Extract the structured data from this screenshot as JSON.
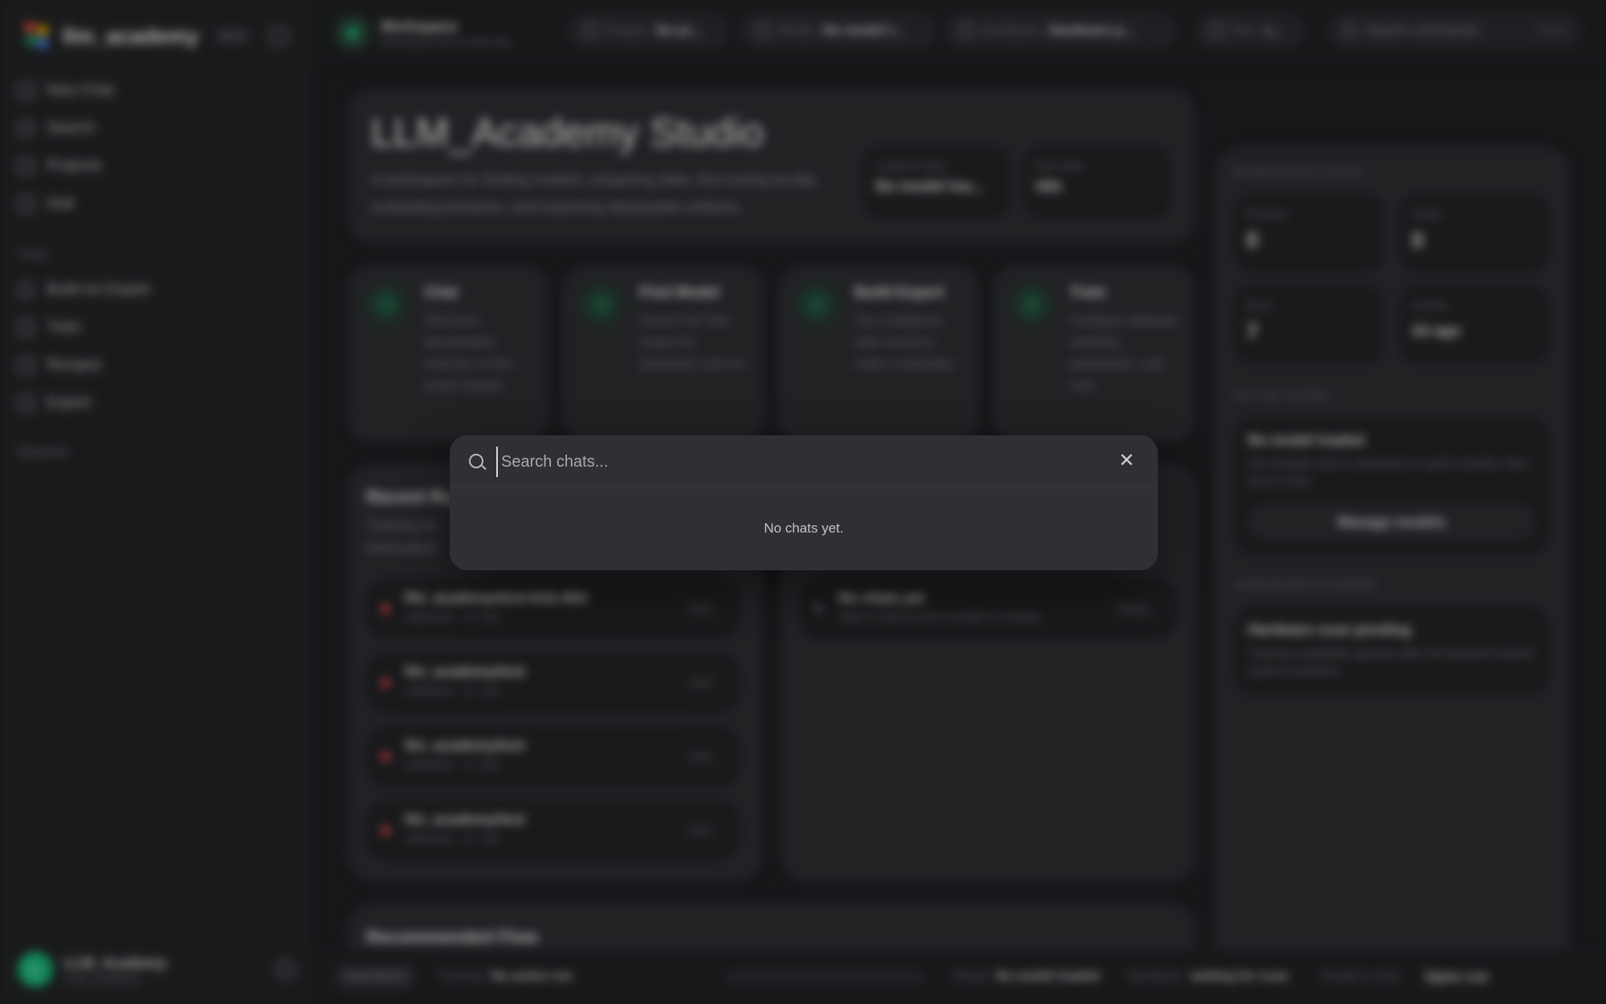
{
  "app": {
    "brand": "llm_academy",
    "beta": "BETA"
  },
  "sidebar": {
    "items": [
      {
        "label": "New Chat",
        "icon": "edit-icon"
      },
      {
        "label": "Search",
        "icon": "search-icon"
      },
      {
        "label": "Projects",
        "icon": "folder-icon"
      },
      {
        "label": "Hub",
        "icon": "grid-icon"
      }
    ],
    "train_label": "Train",
    "train_items": [
      {
        "label": "Build an Expert",
        "icon": "bulb-icon"
      },
      {
        "label": "Train",
        "icon": "flask-icon"
      },
      {
        "label": "Recipes",
        "icon": "chef-icon"
      },
      {
        "label": "Export",
        "icon": "export-icon"
      }
    ],
    "recents_label": "Recents",
    "user": {
      "initial": "L",
      "name": "LLM_Academy",
      "sub": "LLM_Academy"
    }
  },
  "topbar": {
    "workspace_title": "Workspace",
    "workspace_sub": "Workspace-first model lab",
    "project_key": "Project",
    "project_value": "No pr...",
    "model_key": "Model",
    "model_value": "No model l...",
    "hardware_key": "Hardware",
    "hardware_value": "Hardware p...",
    "run_key": "Run",
    "run_value": "i...",
    "search_label": "Search commands",
    "shortcut": "Cmd K"
  },
  "hero": {
    "title": "LLM_Academy Studio",
    "desc": "A workspace for finding models, preparing data, fine-tuning locally, evaluating behavior, and exporting deployable artifacts.",
    "loaded_model_key": "Loaded model",
    "loaded_model_value": "No model loa...",
    "run_state_key": "Run state",
    "run_state_value": "Idle"
  },
  "features": [
    {
      "title": "Chat",
      "desc": "Test base, downloaded, external, or fine-tuned models."
    },
    {
      "title": "Find Model",
      "desc": "Search the Hub, inspect fit, download, and run."
    },
    {
      "title": "Build Expert",
      "desc": "Use a beginner-safe wizard to make a specialist."
    },
    {
      "title": "Train",
      "desc": "Configure datasets, methods, parameters, and runs."
    }
  ],
  "recent_runs": {
    "title": "Recent Ru...",
    "sub": "Training ac... interrupted...",
    "items": [
      {
        "name": "llm_academy/test-bnb-4bit",
        "sub": "unknown · 17 Jun",
        "status": "error"
      },
      {
        "name": "llm_academy/test",
        "sub": "unknown · 17 Jun",
        "status": "error"
      },
      {
        "name": "llm_academy/test",
        "sub": "unknown · 17 Jun",
        "status": "error"
      },
      {
        "name": "llm_academy/test",
        "sub": "unknown · 17 Jun",
        "status": "error"
      }
    ]
  },
  "recent_chats": {
    "item_name": "No chats yet",
    "item_sub": "Start a chat to test a model or compar...",
    "item_badge": "Ready"
  },
  "recommended": {
    "title": "Recommended Flow"
  },
  "workspace_state": {
    "caption": "WORKSPACE STATE",
    "projects_key": "Projects",
    "projects_value": "0",
    "chats_key": "Chats",
    "chats_value": "0",
    "runs_key": "Runs",
    "runs_value": "7",
    "activity_key": "Activity",
    "activity_value": "2d ago"
  },
  "active_model": {
    "caption": "ACTIVE MODEL",
    "title": "No model loaded",
    "desc": "Use Models Hub to download or switch models, then test in Chat.",
    "button": "Manage models"
  },
  "hardware_planner": {
    "caption": "HARDWARE PLANNER",
    "title": "Hardware scan pending",
    "desc": "Training availability appears after the backend reports system hardware."
  },
  "statusbar": {
    "operations": "Operations",
    "training_key": "Training",
    "training_value": "No active run",
    "model_key": "Model",
    "model_value": "No model loaded",
    "hardware_key": "Hardware",
    "hardware_value": "waiting for scan",
    "ready": "Ready to train",
    "open_run": "Open run"
  },
  "dialog": {
    "placeholder": "Search chats...",
    "empty": "No chats yet."
  },
  "colors": {
    "accent": "#1fa06a",
    "error": "#e54848",
    "background": "#1b1c1f",
    "dialog": "#2f3034"
  }
}
